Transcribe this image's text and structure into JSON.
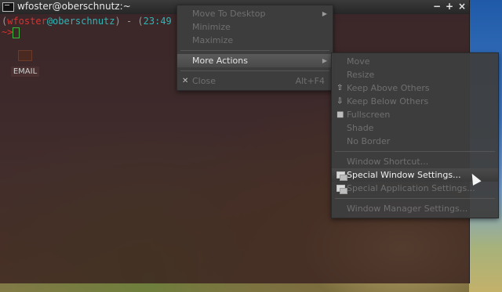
{
  "window": {
    "title": "wfoster@oberschnutz:~",
    "controls": {
      "minimize": "−",
      "maximize": "+",
      "close": "×"
    }
  },
  "terminal": {
    "line1_open": "(",
    "user": "wfoster",
    "at_host": "@oberschnutz",
    "line1_mid": ") - (",
    "time": "23:49",
    "line2_prompt": "~>"
  },
  "desktop_icon": {
    "label": "EMAIL",
    "icon": "email-icon"
  },
  "context_menu": {
    "items": [
      {
        "label": "Move To Desktop",
        "enabled": false,
        "submenu": true
      },
      {
        "label": "Minimize",
        "enabled": false
      },
      {
        "label": "Maximize",
        "enabled": false
      },
      {
        "label": "More Actions",
        "enabled": true,
        "submenu": true,
        "active": true
      },
      {
        "label": "Close",
        "enabled": false,
        "shortcut": "Alt+F4",
        "icon": "close-icon"
      }
    ]
  },
  "submenu": {
    "items": [
      {
        "label": "Move",
        "enabled": false
      },
      {
        "label": "Resize",
        "enabled": false
      },
      {
        "label": "Keep Above Others",
        "enabled": false,
        "icon": "keep-above-icon"
      },
      {
        "label": "Keep Below Others",
        "enabled": false,
        "icon": "keep-below-icon"
      },
      {
        "label": "Fullscreen",
        "enabled": false,
        "icon": "fullscreen-icon"
      },
      {
        "label": "Shade",
        "enabled": false
      },
      {
        "label": "No Border",
        "enabled": false
      },
      {
        "label": "Window Shortcut...",
        "enabled": false
      },
      {
        "label": "Special Window Settings...",
        "enabled": true,
        "hover": true,
        "icon": "window-settings-icon"
      },
      {
        "label": "Special Application Settings...",
        "enabled": false,
        "icon": "app-settings-icon"
      },
      {
        "label": "Window Manager Settings...",
        "enabled": false
      }
    ]
  }
}
